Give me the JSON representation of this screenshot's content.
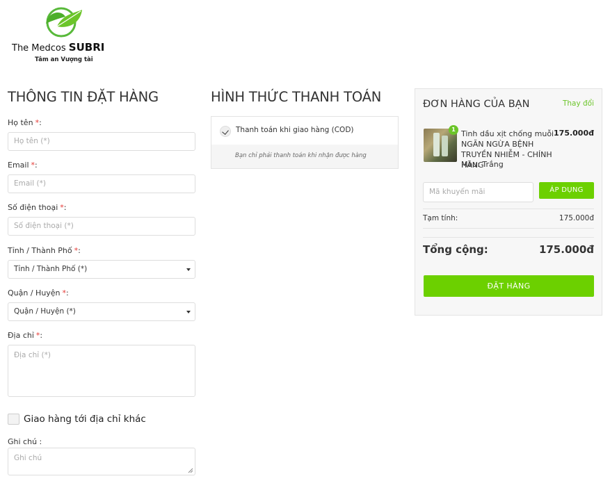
{
  "logo": {
    "brand": "The Medcos",
    "brand_bold": "SUBRI",
    "tagline": "Tâm an Vượng tài"
  },
  "checkout": {
    "title": "THÔNG TIN ĐẶT HÀNG",
    "required_mark": "*",
    "fields": {
      "name": {
        "label": "Họ tên",
        "placeholder": "Họ tên (*)"
      },
      "email": {
        "label": "Email",
        "placeholder": "Email (*)"
      },
      "phone": {
        "label": "Số điện thoại",
        "placeholder": "Số điện thoại (*)"
      },
      "city": {
        "label": "Tỉnh / Thành Phố",
        "value": "Tỉnh / Thành Phố (*)"
      },
      "district": {
        "label": "Quận / Huyện",
        "value": "Quận / Huyện (*)"
      },
      "address": {
        "label": "Địa chỉ",
        "placeholder": "Địa chỉ (*)"
      }
    },
    "ship_other_label": "Giao hàng tới địa chỉ khác",
    "note": {
      "label": "Ghi chú :",
      "placeholder": "Ghi chú"
    }
  },
  "payment": {
    "title": "HÌNH THỨC THANH TOÁN",
    "option_label": "Thanh toán khi giao hàng (COD)",
    "option_note": "Bạn chỉ phải thanh toán khi nhận được hàng"
  },
  "order": {
    "title": "ĐƠN HÀNG CỦA BẠN",
    "change_label": "Thay đổi",
    "item": {
      "quantity": "1",
      "name": "Tinh dầu xịt chống muỗi NGĂN NGỪA BỆNH TRUYỀN NHIỄM - CHÍNH HÃNG",
      "variant": "Màu: Trắng",
      "price": "175.000đ"
    },
    "coupon_placeholder": "Mã khuyến mãi",
    "apply_label": "ÁP DỤNG",
    "subtotal_label": "Tạm tính:",
    "subtotal_value": "175.000đ",
    "total_label": "Tổng cộng:",
    "total_value": "175.000đ",
    "submit_label": "ĐẶT HÀNG"
  },
  "colors": {
    "accent_green": "#6cd000",
    "link_green": "#6cc52a",
    "required_red": "#e53935"
  }
}
